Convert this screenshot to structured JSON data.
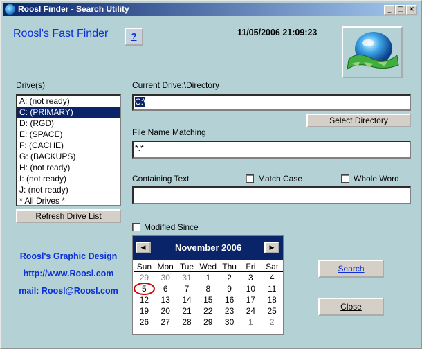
{
  "window": {
    "title": "Roosl Finder - Search Utility",
    "min_glyph": "_",
    "max_glyph": "□",
    "close_glyph": "×"
  },
  "header": {
    "brand": "Roosl's Fast Finder",
    "help_label": "?",
    "datetime": "11/05/2006 21:09:23"
  },
  "drives": {
    "label": "Drive(s)",
    "items": [
      "A: (not ready)",
      "C: (PRIMARY)",
      "D: (RGD)",
      "E: (SPACE)",
      "F: (CACHE)",
      "G: (BACKUPS)",
      "H: (not ready)",
      "I: (not ready)",
      "J: (not ready)",
      "* All Drives *"
    ],
    "selected_index": 1,
    "refresh_label": "Refresh Drive List"
  },
  "directory": {
    "label": "Current Drive:\\Directory",
    "value": "C:\\",
    "select_label": "Select Directory"
  },
  "filename": {
    "label": "File Name Matching",
    "value": "*.*"
  },
  "containing": {
    "label": "Containing Text",
    "match_case_label": "Match Case",
    "whole_word_label": "Whole Word",
    "value": "",
    "match_case_checked": false,
    "whole_word_checked": false
  },
  "modified": {
    "label": "Modified Since",
    "checked": false
  },
  "calendar": {
    "month_label": "November 2006",
    "prev_glyph": "◀",
    "next_glyph": "▶",
    "days_of_week": [
      "Sun",
      "Mon",
      "Tue",
      "Wed",
      "Thu",
      "Fri",
      "Sat"
    ],
    "weeks": [
      [
        "29",
        "30",
        "31",
        "1",
        "2",
        "3",
        "4"
      ],
      [
        "5",
        "6",
        "7",
        "8",
        "9",
        "10",
        "11"
      ],
      [
        "12",
        "13",
        "14",
        "15",
        "16",
        "17",
        "18"
      ],
      [
        "19",
        "20",
        "21",
        "22",
        "23",
        "24",
        "25"
      ],
      [
        "26",
        "27",
        "28",
        "29",
        "30",
        "1",
        "2"
      ]
    ],
    "today": "5"
  },
  "credits": {
    "line1": "Roosl's Graphic Design",
    "line2": "http://www.Roosl.com",
    "line3": "mail: Roosl@Roosl.com"
  },
  "actions": {
    "search_label": "Search",
    "close_label": "Close"
  },
  "colors": {
    "window_bg": "#b4d2d6",
    "accent_blue": "#0a2fd6",
    "selection": "#0a246a",
    "today_ring": "#d00000"
  }
}
